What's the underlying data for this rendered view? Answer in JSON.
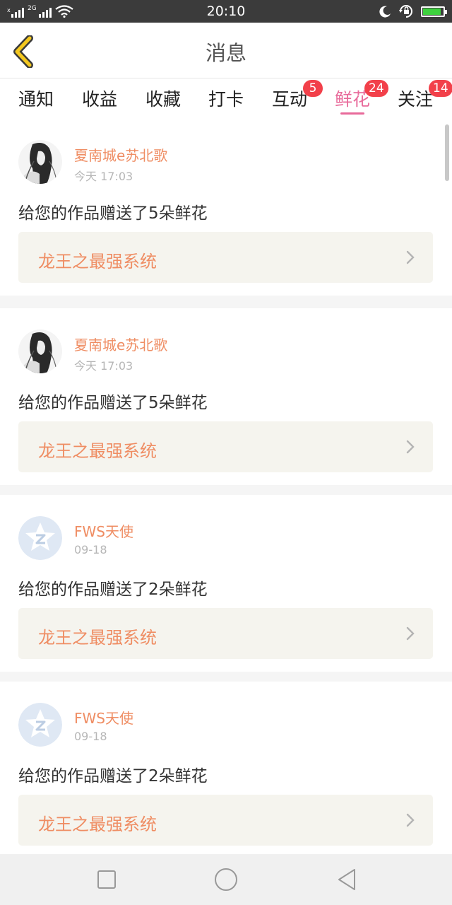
{
  "status_bar": {
    "time": "20:10",
    "network": "2G",
    "icons": [
      "signal-icon",
      "wifi-icon",
      "moon-icon",
      "rotation-lock-icon",
      "battery-icon"
    ],
    "battery_level": 0.9,
    "battery_color": "#3ed13e"
  },
  "header": {
    "title": "消息",
    "back_icon": "chevron-left-icon"
  },
  "tabs": [
    {
      "label": "通知",
      "badge": "",
      "active": false
    },
    {
      "label": "收益",
      "badge": "",
      "active": false
    },
    {
      "label": "收藏",
      "badge": "",
      "active": false
    },
    {
      "label": "打卡",
      "badge": "",
      "active": false
    },
    {
      "label": "互动",
      "badge": "5",
      "active": false
    },
    {
      "label": "鲜花",
      "badge": "24",
      "active": true
    },
    {
      "label": "关注",
      "badge": "14",
      "active": false
    }
  ],
  "colors": {
    "accent_pink": "#e86a9a",
    "name_orange": "#ef8d63",
    "badge_red": "#f2404a"
  },
  "messages": [
    {
      "user": "夏南城e苏北歌",
      "time": "今天 17:03",
      "text": "给您的作品赠送了5朵鲜花",
      "work": "龙王之最强系统",
      "avatar": "girl-portrait-avatar"
    },
    {
      "user": "夏南城e苏北歌",
      "time": "今天 17:03",
      "text": "给您的作品赠送了5朵鲜花",
      "work": "龙王之最强系统",
      "avatar": "girl-portrait-avatar"
    },
    {
      "user": "FWS天使",
      "time": "09-18",
      "text": "给您的作品赠送了2朵鲜花",
      "work": "龙王之最强系统",
      "avatar": "default-star-avatar"
    },
    {
      "user": "FWS天使",
      "time": "09-18",
      "text": "给您的作品赠送了2朵鲜花",
      "work": "龙王之最强系统",
      "avatar": "default-star-avatar"
    }
  ],
  "nav_bar": {
    "icons": [
      "square-recents-icon",
      "circle-home-icon",
      "triangle-back-icon"
    ]
  }
}
